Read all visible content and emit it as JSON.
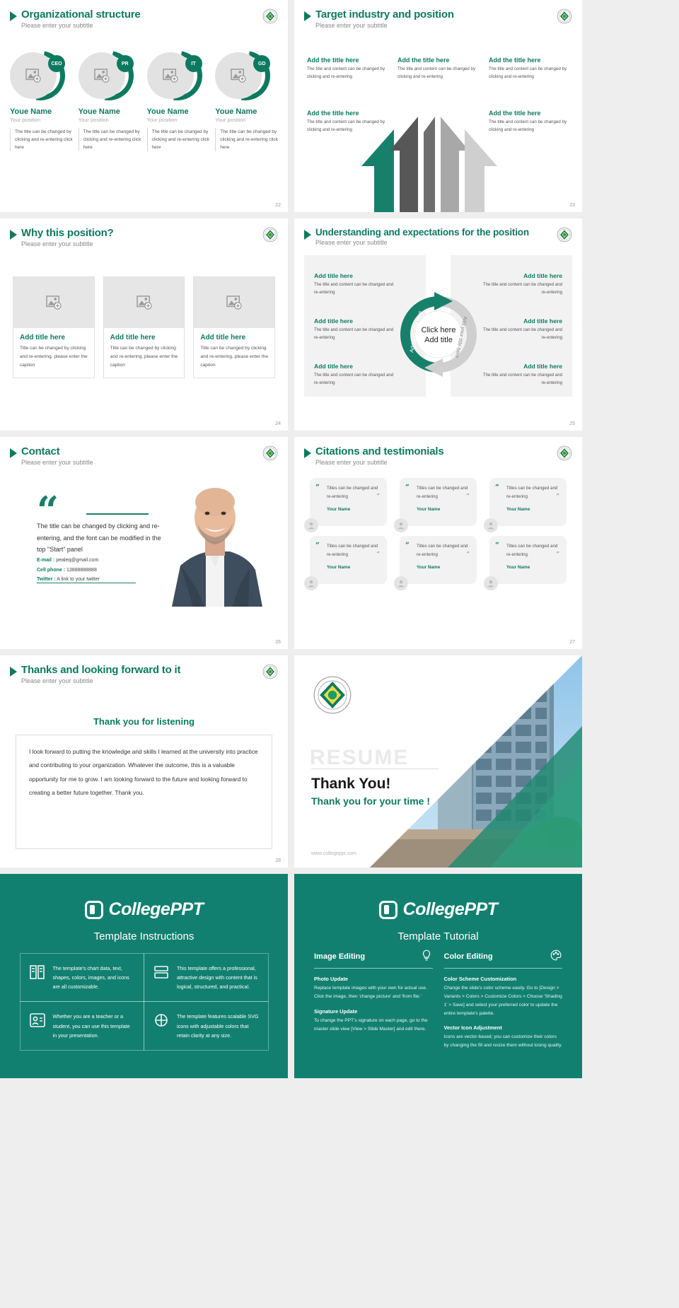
{
  "common": {
    "subtitle": "Please enter your subtitle",
    "logo_name": "university-seal-logo"
  },
  "slides": [
    {
      "id": "organizational-structure",
      "title": "Organizational structure",
      "page": "22",
      "people": [
        {
          "badge": "CEO",
          "name": "Youe Name",
          "position": "Your position",
          "desc": "The title can be changed by clicking and re-entering click here"
        },
        {
          "badge": "PR",
          "name": "Youe Name",
          "position": "Your position",
          "desc": "The title can be changed by clicking and re-entering click here"
        },
        {
          "badge": "IT",
          "name": "Youe Name",
          "position": "Your position",
          "desc": "The title can be changed by clicking and re-entering click here"
        },
        {
          "badge": "GD",
          "name": "Youe Name",
          "position": "Your position",
          "desc": "The title can be changed by clicking and re-entering click here"
        }
      ]
    },
    {
      "id": "target-industry-and-position",
      "title": "Target industry and position",
      "page": "23",
      "items": [
        {
          "title": "Add the title here",
          "body": "The title and content can be changed by clicking and re-entering"
        },
        {
          "title": "Add the title here",
          "body": "The title and content can be changed by clicking and re-entering"
        },
        {
          "title": "Add the title here",
          "body": "The title and content can be changed by clicking and re-entering"
        },
        {
          "title": "Add the title here",
          "body": "The title and content can be changed by clicking and re-entering"
        },
        {
          "title": "Add the title here",
          "body": "The title and content can be changed by clicking and re-entering"
        }
      ]
    },
    {
      "id": "why-this-position",
      "title": "Why this position?",
      "page": "24",
      "cards": [
        {
          "title": "Add title here",
          "body": "Title can be changed by clicking and re-entering, please enter the caption"
        },
        {
          "title": "Add title here",
          "body": "Title can be changed by clicking and re-entering, please enter the caption"
        },
        {
          "title": "Add title here",
          "body": "Title can be changed by clicking and re-entering, please enter the caption"
        }
      ]
    },
    {
      "id": "understanding-and-expectations",
      "title": "Understanding and expectations for the position",
      "page": "25",
      "left": [
        {
          "title": "Add title here",
          "body": "The title and content can be changed and re-entering"
        },
        {
          "title": "Add title here",
          "body": "The title and content can be changed and re-entering"
        },
        {
          "title": "Add title here",
          "body": "The title and content can be changed and re-entering"
        }
      ],
      "right": [
        {
          "title": "Add title here",
          "body": "The title and content can be changed and re-entering"
        },
        {
          "title": "Add title here",
          "body": "The title and content can be changed and re-entering"
        },
        {
          "title": "Add title here",
          "body": "The title and content can be changed and re-entering"
        }
      ],
      "center_line1": "Click here",
      "center_line2": "Add title",
      "ring_left_label": "Add your title here",
      "ring_right_label": "Add your title here"
    },
    {
      "id": "contact",
      "title": "Contact",
      "page": "26",
      "quote": "The title can be changed by clicking and re-entering, and the font can be modified in the top \"Start\" panel",
      "email_label": "E-mail :",
      "email_value": "pealeq@gmail.com",
      "phone_label": "Cell phone  :",
      "phone_value": "13888888888",
      "twitter_label": "Twitter :",
      "twitter_value": "A link to your twitter"
    },
    {
      "id": "citations-and-testimonials",
      "title": "Citations and testimonials",
      "page": "27",
      "quote_text": "Titles can be changed and re-entering",
      "author": "Your Name",
      "count": 6
    },
    {
      "id": "thanks-and-looking-forward",
      "title": "Thanks and looking forward to it",
      "page": "28",
      "heading": "Thank you for listening",
      "body": "I look forward to putting the knowledge and skills I learned at the university into practice and contributing to your organization. Whatever the outcome, this is a valuable opportunity for me to grow. I am looking forward to the future and looking forward to creating a better future together. Thank you."
    },
    {
      "id": "thank-you-cover",
      "resume_word": "RESUME",
      "big": "Thank You!",
      "sub": "Thank you for your time !",
      "url": "www.collegeppt.com"
    }
  ],
  "panels": {
    "instructions": {
      "brand": "CollegePPT",
      "heading": "Template Instructions",
      "cells": [
        {
          "icon": "book-icon",
          "text": "The template's chart data, text, shapes, colors, images, and icons are all customizable."
        },
        {
          "icon": "layers-icon",
          "text": "This template offers a professional, attractive design with content that is logical, structured, and practical."
        },
        {
          "icon": "teacher-icon",
          "text": "Whether you are a teacher or a student, you can use this template in your presentation."
        },
        {
          "icon": "vector-icon",
          "text": "The template features scalable SVG icons with adjustable colors that retain clarity at any size."
        }
      ]
    },
    "tutorial": {
      "brand": "CollegePPT",
      "heading": "Template Tutorial",
      "columns": [
        {
          "heading": "Image Editing",
          "icon": "lightbulb-icon",
          "blocks": [
            {
              "title": "Photo Update",
              "text": "Replace template images with your own for actual use. Click the image, then 'change picture' and 'from file.'"
            },
            {
              "title": "Signature Update",
              "text": "To change the PPT's signature on each page, go to the master slide view [View > Slide Master] and edit there."
            }
          ]
        },
        {
          "heading": "Color Editing",
          "icon": "palette-icon",
          "blocks": [
            {
              "title": "Color Scheme Customization",
              "text": "Change the slide's color scheme easily. Go to [Design > Variants > Colors > Customize Colors > Choose 'Shading 1' > Save] and select your preferred color to update the entire template's palette."
            },
            {
              "title": "Vector Icon Adjustment",
              "text": "Icons are vector-based; you can customize their colors by changing the fill and resize them without losing quality."
            }
          ]
        }
      ]
    }
  },
  "colors": {
    "accent": "#0d7a60",
    "panel_bg": "#128070",
    "muted": "#888888"
  }
}
